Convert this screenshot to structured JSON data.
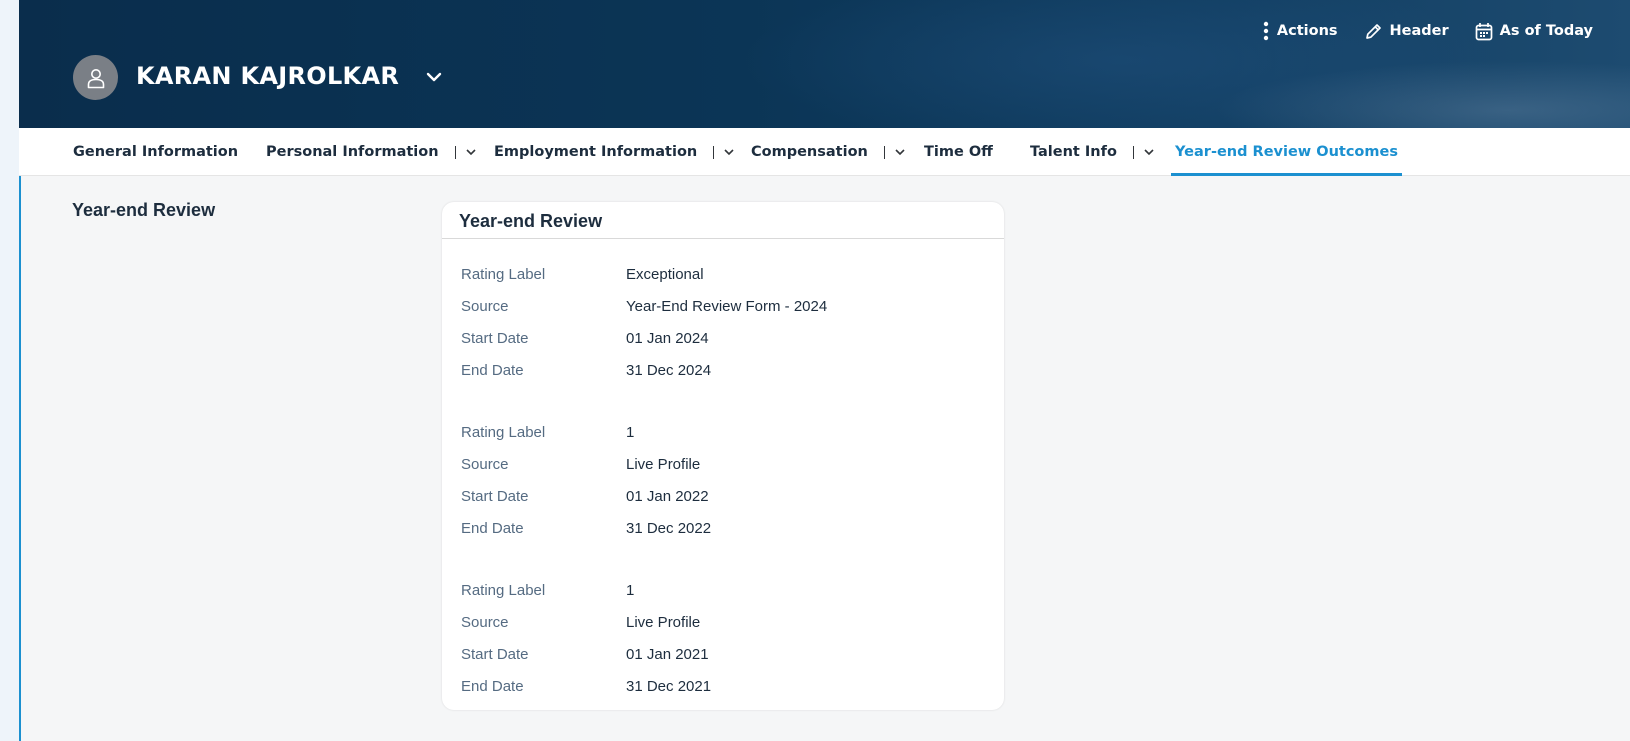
{
  "header": {
    "employee_name": "KARAN KAJROLKAR",
    "actions": [
      {
        "label": "Actions",
        "icon": "vertical-ellipsis-icon"
      },
      {
        "label": "Header",
        "icon": "pencil-icon"
      },
      {
        "label": "As of Today",
        "icon": "calendar-icon"
      }
    ]
  },
  "tabs": [
    {
      "label": "General Information",
      "has_menu": false
    },
    {
      "label": "Personal Information",
      "has_menu": true
    },
    {
      "label": "Employment Information",
      "has_menu": true
    },
    {
      "label": "Compensation",
      "has_menu": true
    },
    {
      "label": "Time Off",
      "has_menu": false
    },
    {
      "label": "Talent Info",
      "has_menu": true
    },
    {
      "label": "Year-end Review Outcomes",
      "has_menu": false,
      "active": true
    }
  ],
  "section": {
    "title": "Year-end Review"
  },
  "card": {
    "title": "Year-end Review",
    "records": [
      {
        "rating_label_key": "Rating Label",
        "rating_label": "Exceptional",
        "source_key": "Source",
        "source": "Year-End Review Form - 2024",
        "start_key": "Start Date",
        "start_date": "01 Jan 2024",
        "end_key": "End Date",
        "end_date": "31 Dec 2024"
      },
      {
        "rating_label_key": "Rating Label",
        "rating_label": "1",
        "source_key": "Source",
        "source": "Live Profile",
        "start_key": "Start Date",
        "start_date": "01 Jan 2022",
        "end_key": "End Date",
        "end_date": "31 Dec 2022"
      },
      {
        "rating_label_key": "Rating Label",
        "rating_label": "1",
        "source_key": "Source",
        "source": "Live Profile",
        "start_key": "Start Date",
        "start_date": "01 Jan 2021",
        "end_key": "End Date",
        "end_date": "31 Dec 2021"
      }
    ]
  },
  "colors": {
    "header_bg": "#0b3556",
    "accent": "#1b90d0",
    "page_bg": "#f5f6f7"
  }
}
